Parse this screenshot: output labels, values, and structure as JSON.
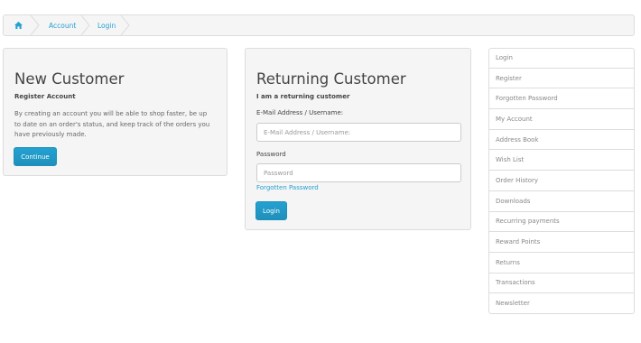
{
  "breadcrumb": {
    "home_icon": "home-icon",
    "items": [
      "Account",
      "Login"
    ]
  },
  "new_customer": {
    "title": "New Customer",
    "subtitle": "Register Account",
    "text": "By creating an account you will be able to shop faster, be up to date on an order's status, and keep track of the orders you have previously made.",
    "button": "Continue"
  },
  "returning_customer": {
    "title": "Returning Customer",
    "subtitle": "I am a returning customer",
    "email_label": "E-Mail Address / Username:",
    "email_placeholder": "E-Mail Address / Username:",
    "email_value": "",
    "password_label": "Password",
    "password_placeholder": "Password",
    "password_value": "",
    "forgotten_link": "Forgotten Password",
    "button": "Login"
  },
  "account_menu": {
    "items": [
      "Login",
      "Register",
      "Forgotten Password",
      "My Account",
      "Address Book",
      "Wish List",
      "Order History",
      "Downloads",
      "Recurring payments",
      "Reward Points",
      "Returns",
      "Transactions",
      "Newsletter"
    ]
  },
  "colors": {
    "accent": "#23a1d1",
    "button": "#229ac8",
    "panel_bg": "#f5f5f5",
    "border": "#dddddd"
  }
}
